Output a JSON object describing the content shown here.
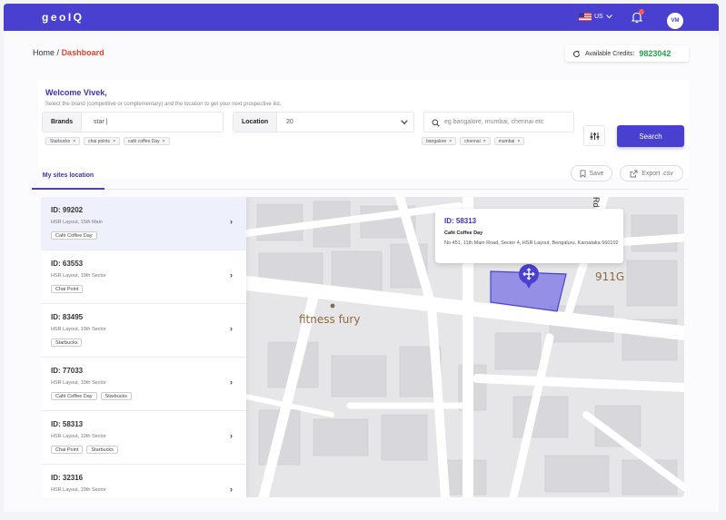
{
  "header": {
    "logo": "geoIQ",
    "language": "US",
    "avatar_initials": "VM"
  },
  "breadcrumb": {
    "home": "Home",
    "separator": "/",
    "current": "Dashboard"
  },
  "credits": {
    "label": "Available Credits:",
    "value": "9823042"
  },
  "welcome": {
    "title": "Welcome Vivek,",
    "subtitle": "Select the brand (competitive or complementary) and the location to get your next prospective list."
  },
  "brands": {
    "label": "Brands",
    "value": "star |",
    "chips": [
      "Starbucks",
      "chai points",
      "café coffee Day"
    ]
  },
  "location": {
    "label": "Location",
    "value": "20"
  },
  "search": {
    "placeholder": "eg bangalore, mumbai, chennai etc",
    "chips": [
      "bangalore",
      "chennai",
      "mumbai"
    ],
    "button_label": "Search"
  },
  "sites": {
    "tab_label": "My sites location",
    "save_label": "Save",
    "export_label": "Export .csv"
  },
  "site_list": [
    {
      "id": "ID: 99202",
      "address": "HSR Layout, 15th Main",
      "tags": [
        "Café Coffee Day"
      ]
    },
    {
      "id": "ID: 63553",
      "address": "HSR Layout, 19th Sector",
      "tags": [
        "Chai Point"
      ]
    },
    {
      "id": "ID: 83495",
      "address": "HSR Layout, 19th Sector",
      "tags": [
        "Starbucks"
      ]
    },
    {
      "id": "ID: 77033",
      "address": "HSR Layout, 19th Sector",
      "tags": [
        "Café Coffee Day",
        "Starbucks"
      ]
    },
    {
      "id": "ID: 58313",
      "address": "HSR Layout, 19th Sector",
      "tags": [
        "Chai Point",
        "Starbucks"
      ]
    },
    {
      "id": "ID: 32316",
      "address": "HSR Layout, 19th Sector",
      "tags": []
    }
  ],
  "popup": {
    "id": "ID: 58313",
    "name": "Café Coffee Day",
    "address": "No 451, 11th Main Road, Sector 4, HSR Layout, Bengaluru, Karnataka 560102"
  },
  "map": {
    "poi_label": "fitness fury",
    "building_label": "911G",
    "street_label": "Rd Street",
    "selection_color": "#5b55d9"
  }
}
